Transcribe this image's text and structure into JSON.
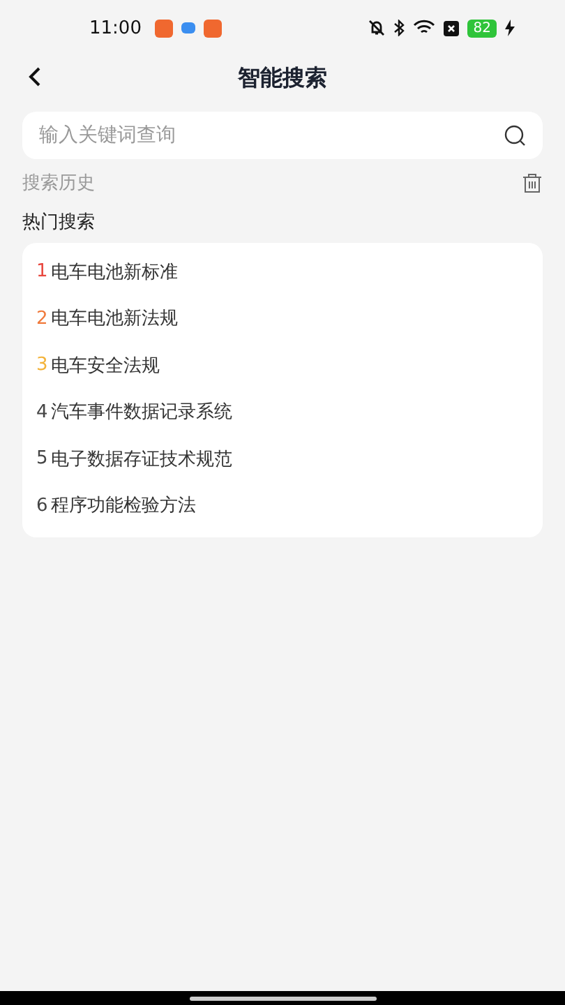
{
  "status_bar": {
    "time": "11:00",
    "battery": "82"
  },
  "header": {
    "title": "智能搜索"
  },
  "search": {
    "placeholder": "输入关键词查询"
  },
  "history": {
    "label": "搜索历史"
  },
  "hot": {
    "label": "热门搜索",
    "items": [
      {
        "rank": "1",
        "text": "电车电池新标准",
        "color": "#e8473e"
      },
      {
        "rank": "2",
        "text": "电车电池新法规",
        "color": "#f07a3c"
      },
      {
        "rank": "3",
        "text": "电车安全法规",
        "color": "#f3b33a"
      },
      {
        "rank": "4",
        "text": "汽车事件数据记录系统",
        "color": "#444444"
      },
      {
        "rank": "5",
        "text": "电子数据存证技术规范",
        "color": "#444444"
      },
      {
        "rank": "6",
        "text": "程序功能检验方法",
        "color": "#444444"
      }
    ]
  }
}
